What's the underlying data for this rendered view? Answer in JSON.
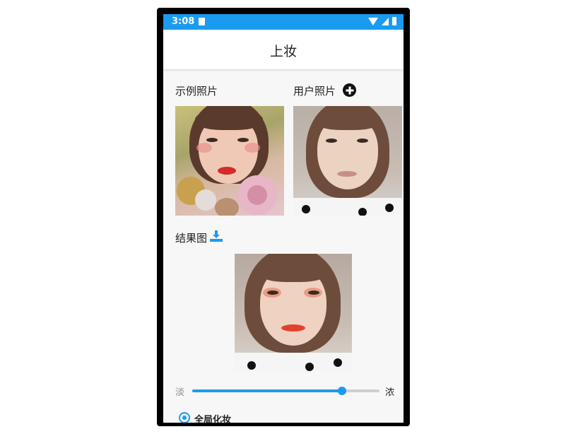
{
  "status_bar": {
    "time": "3:08"
  },
  "app_bar": {
    "title": "上妆"
  },
  "sections": {
    "example_label": "示例照片",
    "user_label": "用户照片",
    "result_label": "结果图"
  },
  "slider": {
    "min_label": "淡",
    "max_label": "浓",
    "value_percent": 80
  },
  "options": {
    "full_face_label": "全局化妆",
    "selected": true
  },
  "colors": {
    "accent": "#1a9bf0"
  }
}
